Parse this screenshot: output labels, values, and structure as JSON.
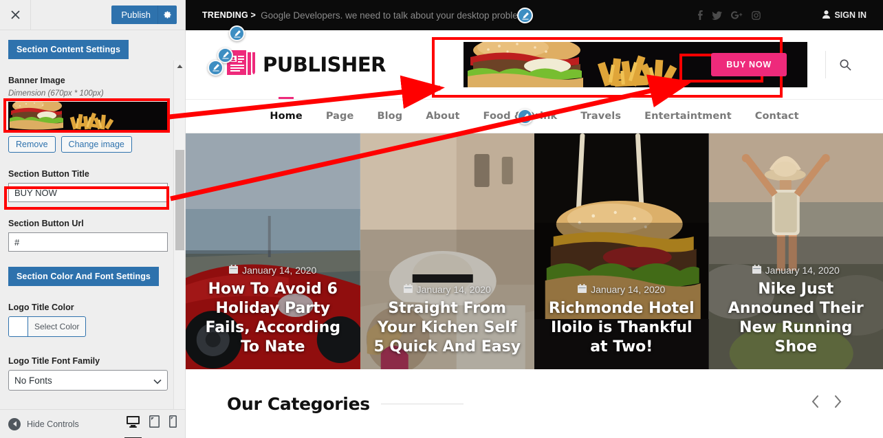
{
  "customizer": {
    "close_icon": "close-icon",
    "publish_label": "Publish",
    "gear_icon": "gear-icon",
    "section_content_settings": "Section Content Settings",
    "banner_image_label": "Banner Image",
    "banner_image_hint": "Dimension (670px * 100px)",
    "remove_label": "Remove",
    "change_image_label": "Change image",
    "section_button_title_label": "Section Button Title",
    "section_button_title_value": "BUY NOW",
    "section_button_url_label": "Section Button Url",
    "section_button_url_value": "#",
    "section_color_font_settings": "Section Color And Font Settings",
    "logo_title_color_label": "Logo Title Color",
    "select_color_label": "Select Color",
    "logo_title_font_family_label": "Logo Title Font Family",
    "logo_title_font_family_value": "No Fonts",
    "font_options": [
      "No Fonts"
    ],
    "hide_controls_label": "Hide Controls",
    "devices": [
      {
        "name": "desktop-preview",
        "icon": "desktop-icon",
        "active": true
      },
      {
        "name": "tablet-preview",
        "icon": "tablet-icon",
        "active": false
      },
      {
        "name": "mobile-preview",
        "icon": "mobile-icon",
        "active": false
      }
    ],
    "accent_color": "#2e72ad"
  },
  "site": {
    "topbar": {
      "trending_label": "TRENDING >",
      "trending_text": "Google Developers. we need to talk about your desktop problem",
      "social": [
        "facebook-icon",
        "twitter-icon",
        "google-plus-icon",
        "instagram-icon"
      ],
      "signin_label": "SIGN IN",
      "signin_icon": "user-icon"
    },
    "logo": {
      "icon": "newspaper-icon",
      "text": "PUBLISHER",
      "brand_color": "#ee2a7b"
    },
    "banner": {
      "button_label": "BUY NOW",
      "button_color": "#ee2a7b",
      "image_alt": "burger-and-fries-banner"
    },
    "search_icon": "search-icon",
    "nav": [
      {
        "label": "Home",
        "active": true
      },
      {
        "label": "Page",
        "active": false
      },
      {
        "label": "Blog",
        "active": false
      },
      {
        "label": "About",
        "active": false
      },
      {
        "label": "Food & Drink",
        "active": false
      },
      {
        "label": "Travels",
        "active": false
      },
      {
        "label": "Entertaintment",
        "active": false
      },
      {
        "label": "Contact",
        "active": false
      }
    ],
    "slides": [
      {
        "date": "January 14, 2020",
        "title": "How To Avoid 6 Holiday Party Fails, According To Nate",
        "image_alt": "red-sports-car"
      },
      {
        "date": "January 14, 2020",
        "title": "Straight From Your Kichen Self 5 Quick And Easy",
        "image_alt": "woman-with-straw-hat"
      },
      {
        "date": "January 14, 2020",
        "title": "Richmonde Hotel Iloilo is Thankful at Two!",
        "image_alt": "cheeseburger-closeup"
      },
      {
        "date": "January 14, 2020",
        "title": "Nike Just Announed Their New Running Shoe",
        "image_alt": "hiker-arms-raised"
      }
    ],
    "categories_section": {
      "title": "Our Categories",
      "prev_icon": "chevron-left-icon",
      "next_icon": "chevron-right-icon"
    }
  },
  "annotation": {
    "highlight_color": "#ff0000",
    "boxes": [
      {
        "name": "banner-thumbnail-highlight"
      },
      {
        "name": "section-button-title-highlight"
      },
      {
        "name": "preview-banner-highlight"
      },
      {
        "name": "preview-buynow-highlight"
      }
    ]
  }
}
